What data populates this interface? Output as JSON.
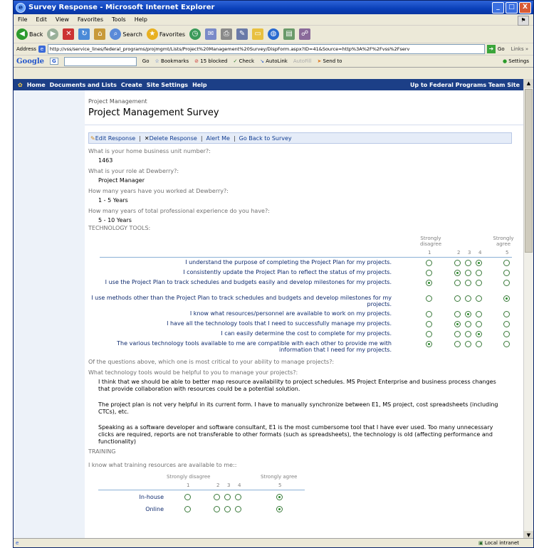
{
  "window": {
    "title": "Survey Response - Microsoft Internet Explorer",
    "min": "_",
    "max": "□",
    "close": "X",
    "ie_glyph": "e"
  },
  "menu": [
    "File",
    "Edit",
    "View",
    "Favorites",
    "Tools",
    "Help"
  ],
  "toolbar": {
    "back": "Back",
    "search": "Search",
    "favorites": "Favorites"
  },
  "address": {
    "label": "Address",
    "url": "http://vss/service_lines/federal_programs/projmgmt/Lists/Project%20Management%20Survey/DispForm.aspx?ID=41&Source=http%3A%2F%2Fvss%2Fserv",
    "go": "Go",
    "links": "Links »"
  },
  "google": {
    "logo": "Google",
    "g_badge": "G",
    "go": "Go",
    "bookmarks": "Bookmarks",
    "blocked": "15 blocked",
    "check": "Check",
    "autolink": "AutoLink",
    "autofill": "AutoFill",
    "sendto": "Send to",
    "settings": "Settings"
  },
  "nav": {
    "items": [
      "Home",
      "Documents and Lists",
      "Create",
      "Site Settings",
      "Help"
    ],
    "right": "Up to Federal Programs Team Site"
  },
  "header": {
    "crumb": "Project Management",
    "title": "Project Management Survey"
  },
  "actions": [
    "Edit Response",
    "Delete Response",
    "Alert Me",
    "Go Back to Survey"
  ],
  "qa": [
    {
      "q": "What is your home business unit number?:",
      "a": "1463"
    },
    {
      "q": "What is your role at Dewberry?:",
      "a": "Project Manager"
    },
    {
      "q": "How many years have you worked at Dewberry?:",
      "a": "1 - 5 Years"
    },
    {
      "q": "How many years of total professional experience do you have?:",
      "a": "5 - 10 Years"
    }
  ],
  "tech": {
    "section": "TECHNOLOGY TOOLS:",
    "scale_low": "Strongly disagree",
    "scale_high": "Strongly agree",
    "scale_nums": [
      "1",
      "2",
      "3",
      "4",
      "5"
    ],
    "rows": [
      {
        "text": "I understand the purpose of completing the Project Plan for my projects.",
        "sel": 4
      },
      {
        "text": "I consistently update the Project Plan to reflect the status of my projects.",
        "sel": 2
      },
      {
        "text": "I use the Project Plan to track schedules and budgets easily and develop milestones for my projects.",
        "sel": 1
      },
      {
        "text": "I use methods other than the Project Plan to track schedules and budgets and develop milestones for my projects.",
        "sel": 5
      },
      {
        "text": "I know what resources/personnel are available to work on my projects.",
        "sel": 3
      },
      {
        "text": "I have all the technology tools that I need to successfully manage my projects.",
        "sel": 2
      },
      {
        "text": "I can easily determine the cost to complete for my projects.",
        "sel": 4
      },
      {
        "text": "The various technology tools available to me are compatible with each other to provide me with information that I need for my projects.",
        "sel": 1
      }
    ]
  },
  "critical_q": "Of the questions above, which one is most critical to your ability to manage projects?:",
  "tools_q": "What technology tools would be helpful to you to manage your projects?:",
  "tools_a": [
    "I think that we should be able to better map resource availability to project schedules.  MS Project Enterprise and business process changes that provide collaboration with resources could be a potential solution.",
    "The project plan is not very helpful in its current form.  I have to manually synchronize between E1, MS project, cost spreadsheets (including CTCs), etc.",
    "Speaking as a software developer and software consultant, E1 is the most cumbersome tool that I have ever used.  Too many unnecessary clicks are required, reports are not transferable to other formats (such as spreadsheets), the technology is old (affecting performance and functionality)"
  ],
  "training": {
    "section": "TRAINING",
    "q": "I know what training resources are available to me::",
    "scale_low": "Strongly disagree",
    "scale_high": "Strongly agree",
    "scale_nums": [
      "1",
      "2",
      "3",
      "4",
      "5"
    ],
    "rows": [
      {
        "text": "In-house",
        "sel": 5
      },
      {
        "text": "Online",
        "sel": 5
      }
    ]
  },
  "status": {
    "zone": "Local intranet"
  }
}
